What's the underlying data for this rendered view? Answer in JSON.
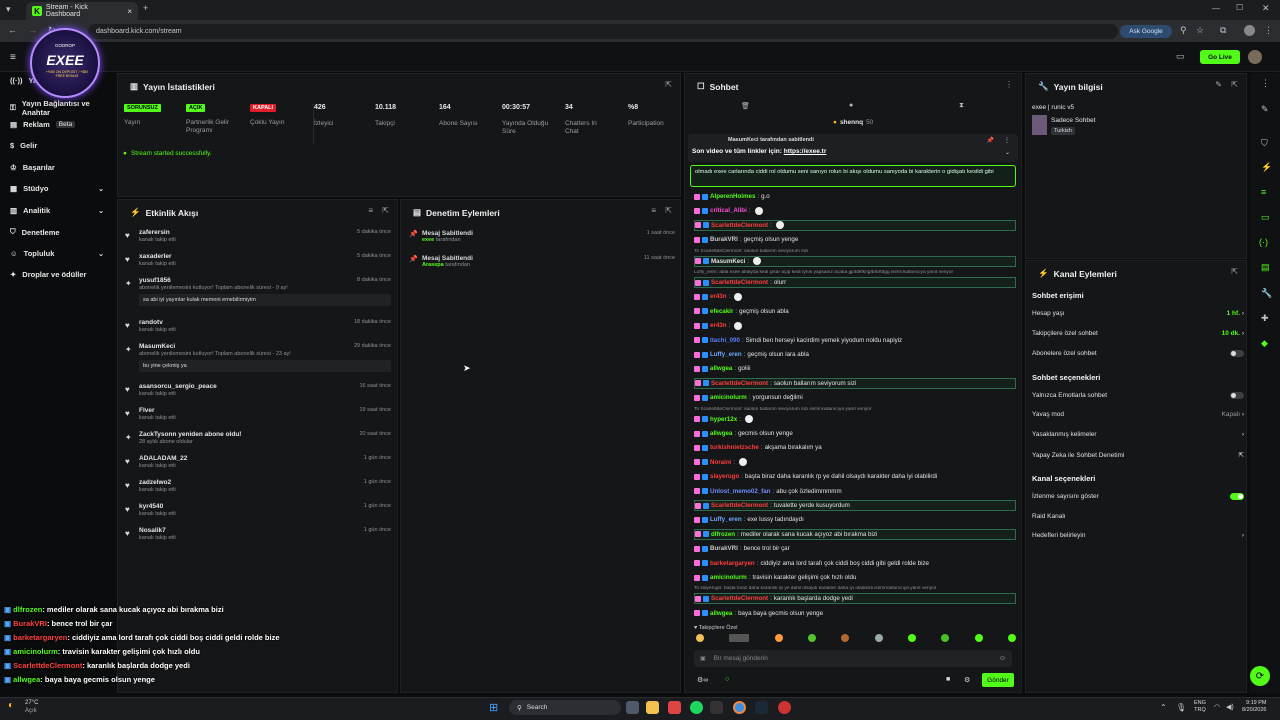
{
  "browser": {
    "tab_title": "Stream - Kick Dashboard",
    "new_tab": "+",
    "url": "dashboard.kick.com/stream",
    "ask_google": "Ask Google"
  },
  "header": {
    "go_live": "Go Live"
  },
  "logo": {
    "brand": "GODROP",
    "name": "EXEE",
    "tagline": "+%50 ON DEPOSIT / +$50 FREE BONUS"
  },
  "sidebar": {
    "items": [
      {
        "label": "Yayın",
        "icon": "stream-icon"
      },
      {
        "label": "Yayın Bağlantısı ve Anahtar",
        "icon": "key-icon"
      },
      {
        "label": "Reklam",
        "icon": "ad-icon",
        "badge": "Beta"
      },
      {
        "label": "Gelir",
        "icon": "money-icon"
      },
      {
        "label": "Başarılar",
        "icon": "trophy-icon"
      },
      {
        "label": "Stüdyo",
        "icon": "studio-icon"
      },
      {
        "label": "Analitik",
        "icon": "chart-icon"
      },
      {
        "label": "Denetleme",
        "icon": "shield-icon"
      },
      {
        "label": "Topluluk",
        "icon": "community-icon"
      },
      {
        "label": "Droplar ve ödüller",
        "icon": "gift-icon"
      }
    ]
  },
  "stats": {
    "title": "Yayın İstatistikleri",
    "items": [
      {
        "value": "SORUNSUZ",
        "label": "Yayın",
        "badge_color": "#53fc18"
      },
      {
        "value": "AÇIK",
        "label": "Partnerlik Gelir Programı",
        "badge_color": "#53fc18"
      },
      {
        "value": "KAPALI",
        "label": "Çoklu Yayın",
        "badge_color": "#e11d2b"
      },
      {
        "value": "426",
        "label": "İzleyici"
      },
      {
        "value": "10.118",
        "label": "Takipçi"
      },
      {
        "value": "164",
        "label": "Abone Sayısı"
      },
      {
        "value": "00:30:57",
        "label": "Yayında Olduğu Süre"
      },
      {
        "value": "34",
        "label": "Chatters In Chat"
      },
      {
        "value": "%8",
        "label": "Participation"
      }
    ],
    "status": "Stream started successfully."
  },
  "activity": {
    "title": "Etkinlik Akışı",
    "items": [
      {
        "name": "zaferersin",
        "sub": "kanalı takip etti",
        "time": "5 dakika önce",
        "icon": "heart-icon"
      },
      {
        "name": "xaxaderler",
        "sub": "kanalı takip etti",
        "time": "5 dakika önce",
        "icon": "heart-icon"
      },
      {
        "name": "yusuf1856",
        "sub": "abonelik yenilemesini kutluyor! Toplam abonelik süresi - 9 ay!",
        "time": "8 dakika önce",
        "icon": "star-icon",
        "msg": "sa abi iyi yayınlar kulak memeni emebilirmiyim"
      },
      {
        "name": "randotv",
        "sub": "kanalı takip etti",
        "time": "18 dakika önce",
        "icon": "heart-icon"
      },
      {
        "name": "MasumKeci",
        "sub": "abonelik yenilemesini kutluyor! Toplam abonelik süresi - 23 ay!",
        "time": "29 dakika önce",
        "icon": "star-icon",
        "msg": "bu yine çekmiş ya"
      },
      {
        "name": "asansorcu_sergio_peace",
        "sub": "kanalı takip etti",
        "time": "16 saat önce",
        "icon": "heart-icon"
      },
      {
        "name": "Flver",
        "sub": "kanalı takip etti",
        "time": "19 saat önce",
        "icon": "heart-icon"
      },
      {
        "name": "ZackTysonn yeniden abone oldu!",
        "sub": "28 aylık abone oldular",
        "time": "20 saat önce",
        "icon": "star-icon"
      },
      {
        "name": "ADALADAM_22",
        "sub": "kanalı takip etti",
        "time": "1 gün önce",
        "icon": "heart-icon"
      },
      {
        "name": "zadzelwo2",
        "sub": "kanalı takip etti",
        "time": "1 gün önce",
        "icon": "heart-icon"
      },
      {
        "name": "kyr4540",
        "sub": "kanalı takip etti",
        "time": "1 gün önce",
        "icon": "heart-icon"
      },
      {
        "name": "Nosalik7",
        "sub": "kanalı takip etti",
        "time": "1 gün önce",
        "icon": "heart-icon"
      }
    ]
  },
  "moderation": {
    "title": "Denetim Eylemleri",
    "items": [
      {
        "title": "Mesaj Sabitlendi",
        "by": "exee",
        "by_suffix": "tarafından",
        "time": "1 saat önce"
      },
      {
        "title": "Mesaj Sabitlendi",
        "by": "Arasepa",
        "by_suffix": "tarafından",
        "time": "11 saat önce"
      }
    ]
  },
  "chat": {
    "title": "Sohbet",
    "top_user": "shennq",
    "top_count": "50",
    "pinned_by": "MasumKeci tarafından sabitlendi",
    "pinned_text": "Son video ve tüm linkler için:",
    "pinned_link": "https://exee.tr",
    "reply_box": "olmadı exee carlarında ciddi rol oldumu seni sanıyo rolun bi akışı oldumu sanıyoda bi karakterin o gidişatı kesildi gibi",
    "messages": [
      {
        "user": "AlperenHolmes",
        "text": "g.o",
        "color": "#53fc18"
      },
      {
        "user": "critical_Alibi",
        "text": "",
        "color": "#ff4fd8"
      },
      {
        "user": "ScarlettdeClermont",
        "text": "",
        "color": "#ff3d3d",
        "hl": true
      },
      {
        "user": "BurakVRI",
        "text": "geçmiş olsun yenge",
        "color": "#c9c9c9"
      },
      {
        "user": "MasumKeci",
        "text": "",
        "color": "#e0e0e0",
        "reply": "To ScarlettdeClermont: saolun ballarım seviyorum sizi",
        "hl": true
      },
      {
        "user": "ScarlettdeClermont",
        "text": "olurr",
        "color": "#ff3d3d",
        "reply": "Luffy_eren: abla exee ablayda kedi çıkar açıp kedi rynni yapsanız acaba jgofdkfkngfbrbrfdgg isimli kullanıcıya yanıt veriyor",
        "hl": true
      },
      {
        "user": "er43n",
        "text": "",
        "color": "#ff3d3d"
      },
      {
        "user": "efecakir",
        "text": "geçmiş olsun abla",
        "color": "#53fc18"
      },
      {
        "user": "er43n",
        "text": "",
        "color": "#ff3d3d"
      },
      {
        "user": "ltachi_090",
        "text": "Simdi ben herseyi kacirdim yemek yiyodum noldu napiyiz",
        "color": "#5b7cff"
      },
      {
        "user": "Luffy_eren",
        "text": "geçmiş olsun lara abla",
        "color": "#6fa8ff"
      },
      {
        "user": "allwgea",
        "text": "goliii",
        "color": "#53fc18"
      },
      {
        "user": "ScarlettdeClermont",
        "text": "saolun ballarım seviyorum sizi",
        "color": "#ff3d3d",
        "hl": true
      },
      {
        "user": "amicinolurm",
        "text": "yorgunsun değilmi",
        "color": "#53fc18"
      },
      {
        "user": "hyper12x",
        "text": "",
        "color": "#53fc18",
        "reply": "To ScarlettdeClermont: saolun ballarım seviyorum sizi isimli kullanıcıya yanıt veriyor"
      },
      {
        "user": "allwgea",
        "text": "gecmis olsun yenge",
        "color": "#53fc18"
      },
      {
        "user": "turkishnietzsche",
        "text": "akşama bırakalım ya",
        "color": "#ff3d3d"
      },
      {
        "user": "Noraini",
        "text": "",
        "color": "#ff3d3d"
      },
      {
        "user": "slayerugo",
        "text": "başta biraz daha karanlık rp ye dahil olsaydı karakter daha iyi olabilirdi",
        "color": "#ff3d3d"
      },
      {
        "user": "Unlost_memo02_fan",
        "text": "abu çok özledimmmmm",
        "color": "#6f8cff"
      },
      {
        "user": "ScarlettdeClermont",
        "text": "tuvalette yerde kusuyordum",
        "color": "#ff3d3d",
        "hl": true
      },
      {
        "user": "Luffy_eren",
        "text": "exe lussy tadındaydı",
        "color": "#6fa8ff"
      },
      {
        "user": "dlfrozen",
        "text": "mediler olarak sana kucak açıyoz abi bırakma bizi",
        "color": "#53fc18",
        "hl": true
      },
      {
        "user": "BurakVRI",
        "text": "bence trol bir çar",
        "color": "#c9c9c9"
      },
      {
        "user": "barketargaryen",
        "text": "ciddiyiz ama lord tarafı çok ciddi boş ciddi gibi geldi rolde bize",
        "color": "#ff3d3d"
      },
      {
        "user": "amicinolurm",
        "text": "travisin karakter gelişimi çok hızlı oldu",
        "color": "#53fc18"
      },
      {
        "user": "ScarlettdeClermont",
        "text": "karanlık başlarda dodge yedi",
        "color": "#ff3d3d",
        "reply": "To slayerugo: başta biraz daha karanlık rp ye dahil olsaydı karakter daha iyi olabilirdi isimli kullanıcıya yanıt veriyor",
        "hl": true
      },
      {
        "user": "allwgea",
        "text": "baya baya gecmis olsun yenge",
        "color": "#53fc18"
      }
    ],
    "followers_only": "Takipçilere Özel",
    "input_placeholder": "Bir mesaj gönderin",
    "send": "Gönder"
  },
  "stream_info": {
    "title": "Yayın bilgisi",
    "stream_title": "exee | runic v5",
    "chat_mode": "Sadece Sohbet",
    "language": "Turkish"
  },
  "channel_actions": {
    "title": "Kanal Eylemleri",
    "chat_access": "Sohbet erişimi",
    "rows1": [
      {
        "label": "Hesap yaşı",
        "value": "1 hf.",
        "value_color": "#53fc18"
      },
      {
        "label": "Takipçilere özel sohbet",
        "value": "10 dk.",
        "value_color": "#53fc18"
      },
      {
        "label": "Abonelere özel sohbet",
        "toggle": "off"
      }
    ],
    "chat_options": "Sohbet seçenekleri",
    "rows2": [
      {
        "label": "Yalnızca Emotlarla sohbet",
        "toggle": "off"
      },
      {
        "label": "Yavaş mod",
        "value": "Kapalı"
      },
      {
        "label": "Yasaklanmış kelimeler",
        "value": ""
      },
      {
        "label": "Yapay Zeka ile Sohbet Denetimi",
        "value": ""
      }
    ],
    "channel_options": "Kanal seçenekleri",
    "rows3": [
      {
        "label": "İzlenme sayısını göster",
        "toggle": "on"
      },
      {
        "label": "Raid Kanalı",
        "value": ""
      },
      {
        "label": "Hedefleri belirleyin",
        "value": ""
      }
    ]
  },
  "overlay": {
    "lines": [
      {
        "user": "dlfrozen",
        "text": ": mediler olarak sana kucak açıyoz abi bırakma bizi",
        "color": "#53fc18"
      },
      {
        "user": "BurakVRI",
        "text": ": bence trol bir çar",
        "color": "#ff4040"
      },
      {
        "user": "barketargaryen",
        "text": ": ciddiyiz ama lord tarafı çok ciddi boş ciddi geldi rolde bize",
        "color": "#ff4040"
      },
      {
        "user": "amicinolurm",
        "text": ": travisin karakter gelişimi çok hızlı oldu",
        "color": "#53fc18"
      },
      {
        "user": "ScarlettdeClermont",
        "text": ": karanlık başlarda dodge yedi",
        "color": "#ff4040"
      },
      {
        "user": "allwgea",
        "text": ": baya baya gecmis olsun yenge",
        "color": "#53fc18"
      }
    ]
  },
  "taskbar": {
    "weather_temp": "27°C",
    "weather_desc": "Açık",
    "search": "Search",
    "lang1": "ENG",
    "lang2": "TRQ",
    "time": "9:19 PM",
    "date": "8/20/2026"
  }
}
